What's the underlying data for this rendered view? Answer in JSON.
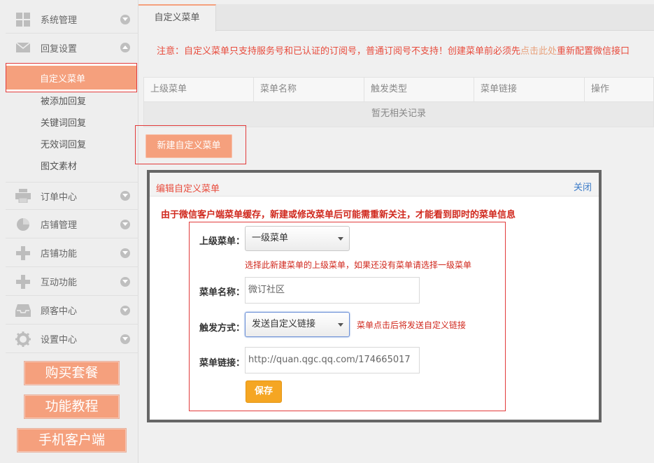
{
  "sidebar": {
    "items": [
      {
        "label": "系统管理",
        "icon": "grid-icon"
      },
      {
        "label": "回复设置",
        "icon": "mail-icon"
      },
      {
        "label": "订单中心",
        "icon": "printer-icon"
      },
      {
        "label": "店铺管理",
        "icon": "pie-icon"
      },
      {
        "label": "店铺功能",
        "icon": "plus-icon"
      },
      {
        "label": "互动功能",
        "icon": "plus-icon"
      },
      {
        "label": "顾客中心",
        "icon": "inbox-icon"
      },
      {
        "label": "设置中心",
        "icon": "gear-icon"
      }
    ],
    "sub_items": [
      "自定义菜单",
      "被添加回复",
      "关键词回复",
      "无效词回复",
      "图文素材"
    ],
    "buttons": [
      "购买套餐",
      "功能教程",
      "手机客户端"
    ]
  },
  "main": {
    "tab": "自定义菜单",
    "notice_prefix": "注意：自定义菜单只支持服务号和已认证的订阅号，普通订阅号不支持！创建菜单前必须先",
    "notice_link": "点击此处",
    "notice_suffix": "重新配置微信接口",
    "table": {
      "headers": [
        "上级菜单",
        "菜单名称",
        "触发类型",
        "菜单链接",
        "操作"
      ],
      "empty_text": "暂无相关记录"
    },
    "new_button": "新建自定义菜单"
  },
  "modal": {
    "title": "编辑自定义菜单",
    "close": "关闭",
    "warning": "由于微信客户端菜单缓存，新建或修改菜单后可能需重新关注，才能看到即时的菜单信息",
    "parent_label": "上级菜单：",
    "parent_value": "一级菜单",
    "parent_hint": "选择此新建菜单的上级菜单，如果还没有菜单请选择一级菜单",
    "name_label": "菜单名称：",
    "name_value": "微订社区",
    "trigger_label": "触发方式：",
    "trigger_value": "发送自定义链接",
    "trigger_hint": "菜单点击后将发送自定义链接",
    "link_label": "菜单链接：",
    "link_value": "http://quan.qgc.qq.com/174665017",
    "save": "保存"
  },
  "colors": {
    "accent": "#f5a07d",
    "alert": "#e84c3d",
    "save": "#f5a623",
    "link": "#3b7bc8"
  }
}
